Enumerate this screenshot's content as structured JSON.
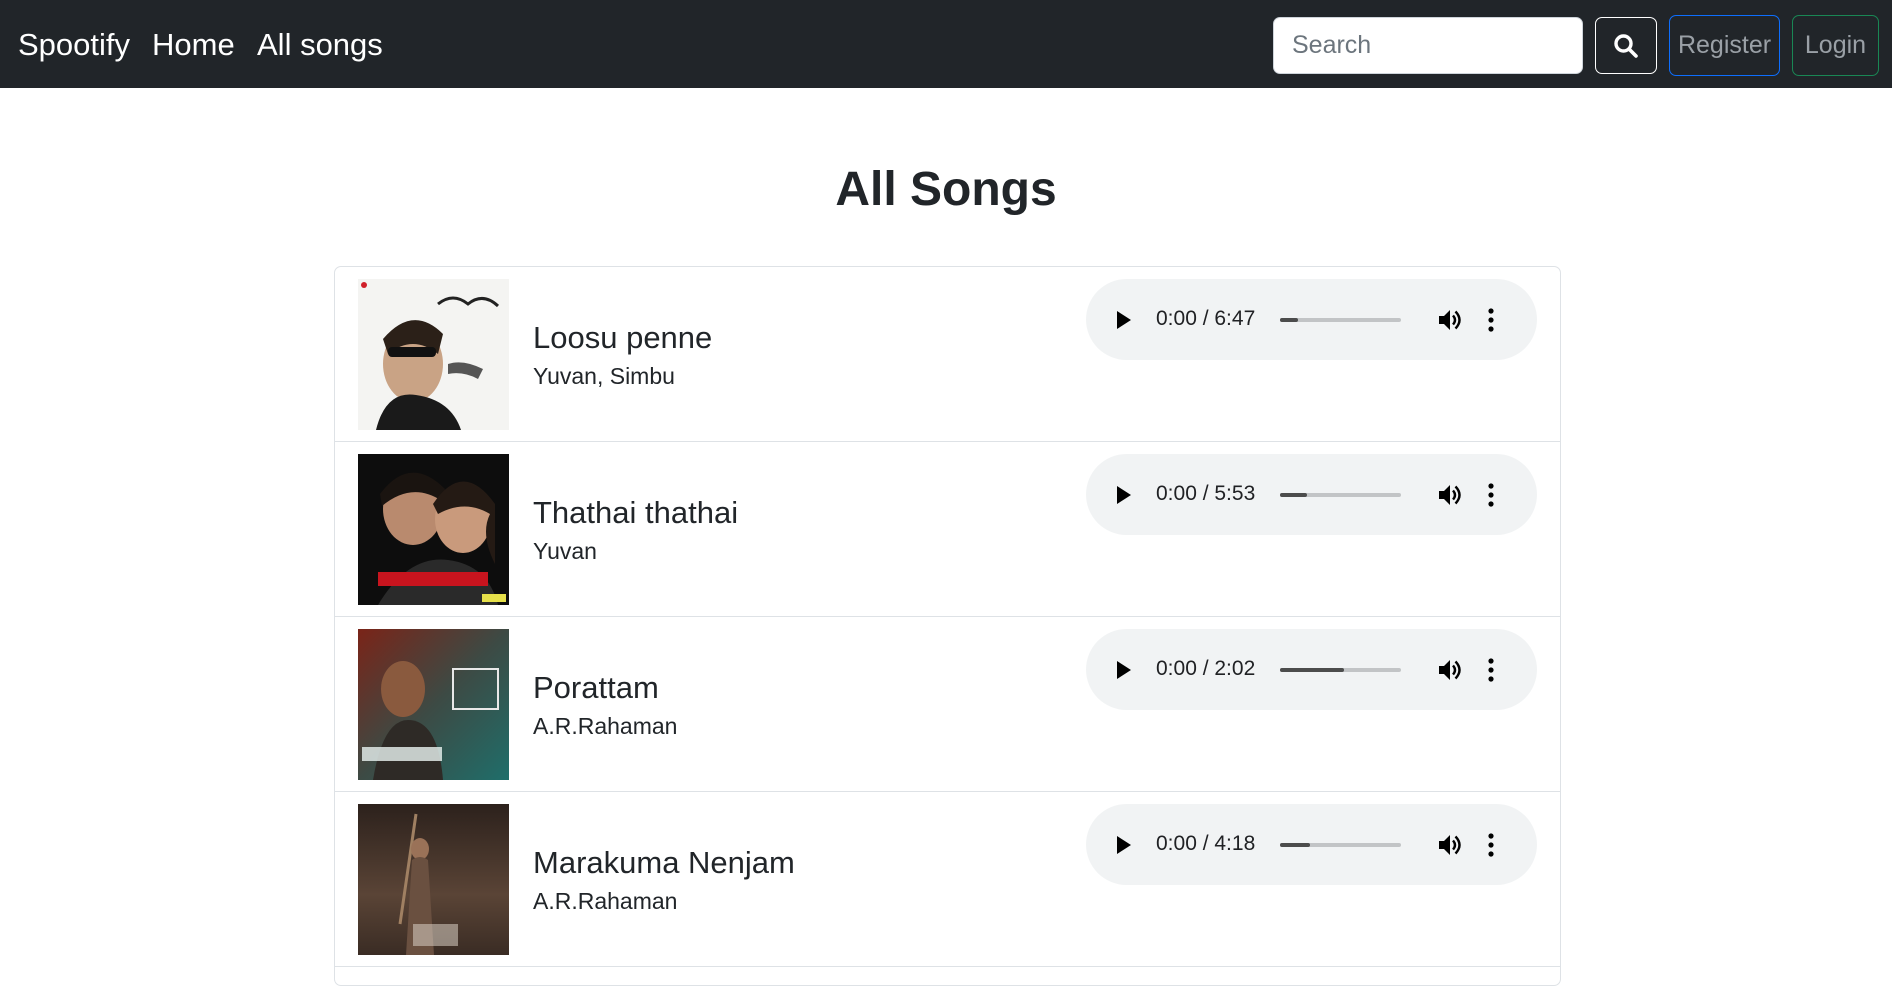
{
  "nav": {
    "brand": "Spootify",
    "home": "Home",
    "all_songs": "All songs",
    "search_placeholder": "Search",
    "register": "Register",
    "login": "Login"
  },
  "page": {
    "title": "All Songs"
  },
  "songs": [
    {
      "title": "Loosu penne",
      "artist": "Yuvan, Simbu",
      "time": "0:00 / 6:47",
      "progress": 0.15
    },
    {
      "title": "Thathai thathai",
      "artist": "Yuvan",
      "time": "0:00 / 5:53",
      "progress": 0.22
    },
    {
      "title": "Porattam",
      "artist": "A.R.Rahaman",
      "time": "0:00 / 2:02",
      "progress": 0.53
    },
    {
      "title": "Marakuma Nenjam",
      "artist": "A.R.Rahaman",
      "time": "0:00 / 4:18",
      "progress": 0.25
    }
  ],
  "colors": {
    "navbar_bg": "#212529",
    "register_border": "#0d6efd",
    "login_border": "#198754",
    "player_bg": "#f1f3f4"
  }
}
